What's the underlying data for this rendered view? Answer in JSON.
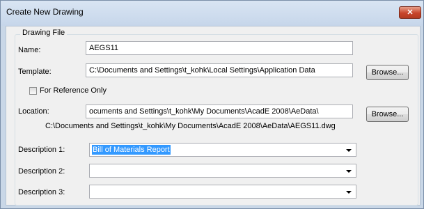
{
  "window": {
    "title": "Create New Drawing",
    "close_icon_glyph": "✕"
  },
  "group": {
    "title": "Drawing File"
  },
  "name": {
    "label": "Name:",
    "value": "AEGS11"
  },
  "template": {
    "label": "Template:",
    "value": "C:\\Documents and Settings\\t_kohk\\Local Settings\\Application Data",
    "browse_label": "Browse..."
  },
  "reference_only": {
    "label": "For Reference Only",
    "checked": false
  },
  "location": {
    "label": "Location:",
    "value": "ocuments and Settings\\t_kohk\\My Documents\\AcadE 2008\\AeData\\",
    "browse_label": "Browse...",
    "full_path": "C:\\Documents and Settings\\t_kohk\\My Documents\\AcadE 2008\\AeData\\AEGS11.dwg"
  },
  "descriptions": [
    {
      "label": "Description 1:",
      "value": "Bill of Materials Report"
    },
    {
      "label": "Description 2:",
      "value": ""
    },
    {
      "label": "Description 3:",
      "value": ""
    }
  ],
  "colors": {
    "title_bar": "#c9d7e7",
    "close_button": "#c8452a",
    "selection": "#3399ff"
  },
  "icons": [
    "close-icon",
    "chevron-down-icon"
  ]
}
